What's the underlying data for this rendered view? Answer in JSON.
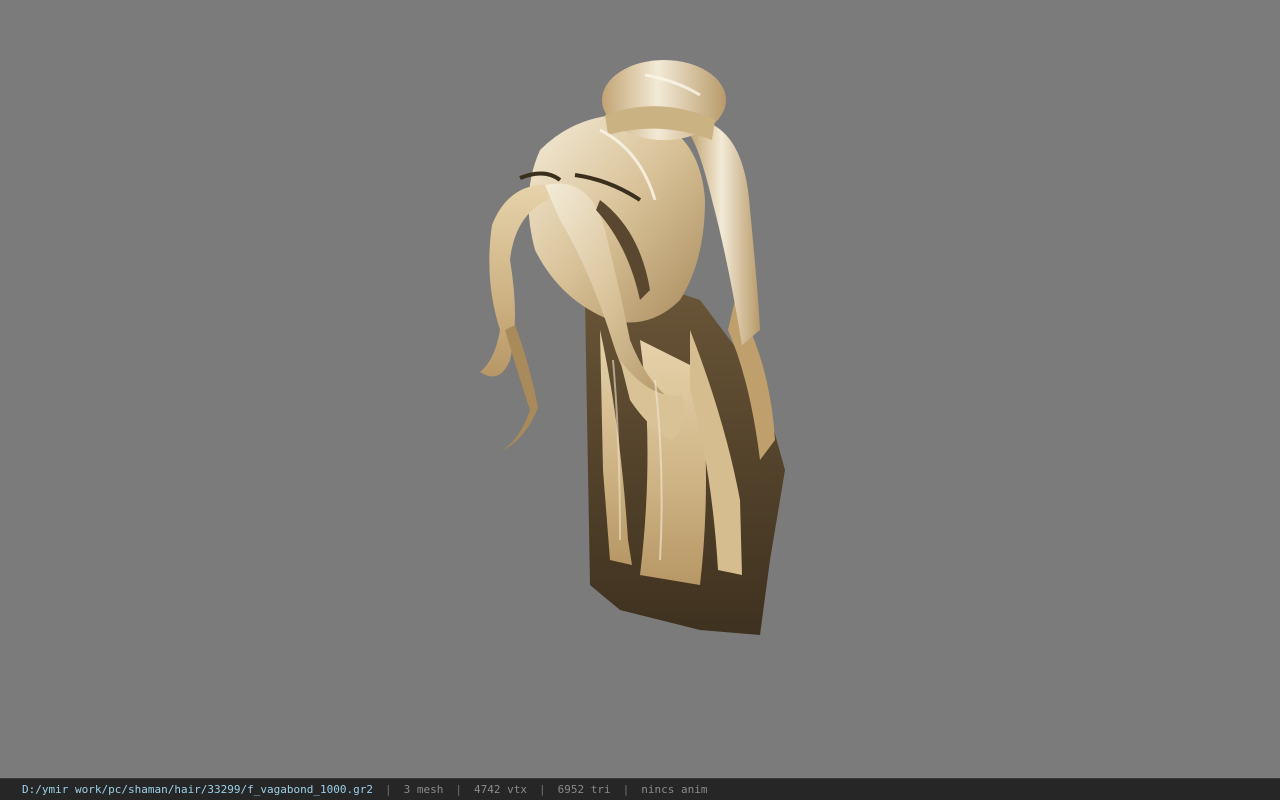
{
  "viewport": {
    "background_color": "#7b7b7b",
    "model": {
      "subject": "blonde ponytail hair mesh",
      "hair_light": "#e9d9b6",
      "hair_mid": "#c9ad7f",
      "hair_dark": "#4c3d28"
    }
  },
  "statusbar": {
    "file_path": "D:/ymir work/pc/shaman/hair/33299/f_vagabond_1000.gr2",
    "separator": "|",
    "mesh_count": "3 mesh",
    "vertex_count": "4742 vtx",
    "triangle_count": "6952 tri",
    "anim_status": "nincs anim"
  }
}
